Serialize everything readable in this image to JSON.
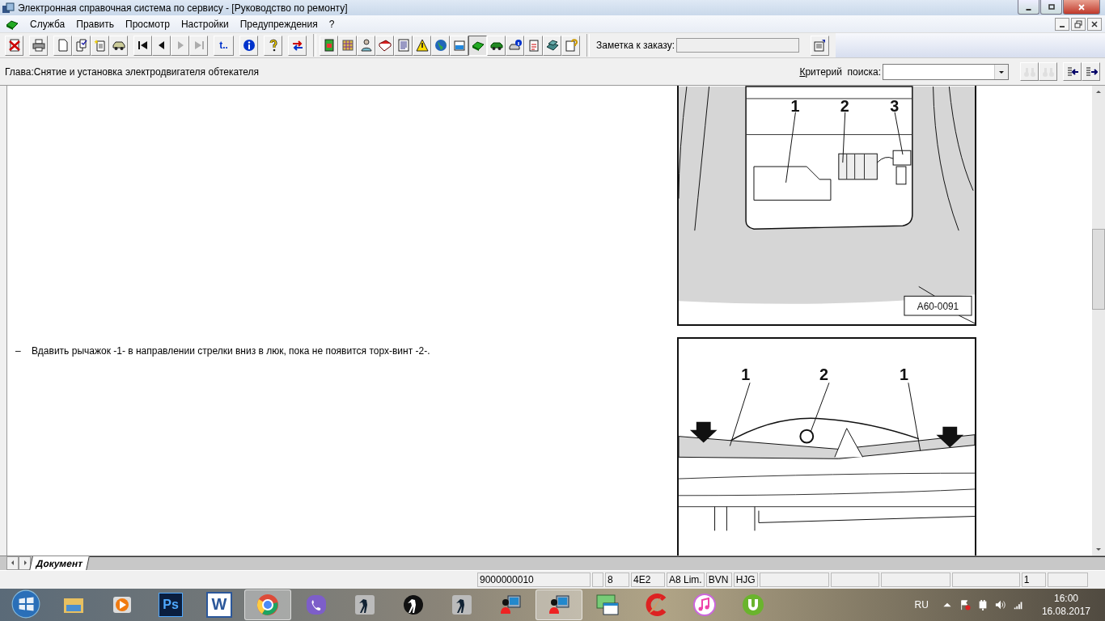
{
  "window": {
    "title": "Электронная справочная система по сервису - [Руководство по ремонту]"
  },
  "menu": [
    {
      "label": "Служба"
    },
    {
      "label": "Править"
    },
    {
      "label": "Просмотр"
    },
    {
      "label": "Настройки"
    },
    {
      "label": "Предупреждения"
    },
    {
      "label": "?"
    }
  ],
  "toolbar": [
    {
      "disabled": false,
      "selected": false
    },
    {
      "disabled": false,
      "selected": false
    },
    {
      "disabled": false,
      "selected": false
    },
    {
      "disabled": false,
      "selected": false
    },
    {
      "disabled": false,
      "selected": false
    },
    {
      "disabled": false,
      "selected": false
    },
    {
      "disabled": false,
      "selected": false
    },
    {
      "disabled": false,
      "selected": false
    },
    {
      "disabled": true,
      "selected": false
    },
    {
      "disabled": true,
      "selected": false
    },
    {
      "disabled": false,
      "selected": false,
      "label": "t.."
    },
    {
      "disabled": false,
      "selected": false
    },
    {
      "disabled": false,
      "selected": false
    },
    {
      "disabled": false,
      "selected": false
    },
    {
      "disabled": false,
      "selected": false
    },
    {
      "disabled": false,
      "selected": false
    },
    {
      "disabled": false,
      "selected": false
    },
    {
      "disabled": false,
      "selected": false
    },
    {
      "disabled": false,
      "selected": false
    },
    {
      "disabled": false,
      "selected": false
    },
    {
      "disabled": false,
      "selected": false
    },
    {
      "disabled": false,
      "selected": false
    },
    {
      "disabled": false,
      "selected": true
    },
    {
      "disabled": false,
      "selected": false
    },
    {
      "disabled": false,
      "selected": false
    },
    {
      "disabled": false,
      "selected": false
    },
    {
      "disabled": false,
      "selected": false
    },
    {
      "disabled": false,
      "selected": false
    }
  ],
  "order_note": {
    "label": "Заметка к заказу:"
  },
  "chapter": "Глава:Снятие и установка электродвигателя обтекателя",
  "search": {
    "label": "Критерий  поиска:"
  },
  "content": [
    {
      "figure": {
        "callouts": [
          "1",
          "2",
          "3"
        ],
        "code": "A60-0091"
      }
    },
    {
      "marker": "–",
      "text": "Вдавить рычажок -1- в направлении стрелки вниз в люк, пока не появится торх-винт -2-.",
      "figure": {
        "callouts": [
          "1",
          "2",
          "1"
        ]
      }
    }
  ],
  "tabs": [
    {
      "label": "Документ",
      "selected": true
    }
  ],
  "status_bar": [
    {
      "kind": "text",
      "text": "9000000010"
    },
    {
      "kind": "blank"
    },
    {
      "kind": "text",
      "text": "8"
    },
    {
      "kind": "text",
      "text": "4E2"
    },
    {
      "kind": "text",
      "text": "A8 Lim."
    },
    {
      "kind": "text",
      "text": "BVN"
    },
    {
      "kind": "text",
      "text": "HJG"
    },
    {
      "kind": "blank"
    },
    {
      "kind": "blank"
    },
    {
      "kind": "blank"
    },
    {
      "kind": "blank"
    },
    {
      "kind": "text",
      "text": "1"
    },
    {
      "kind": "blank"
    }
  ],
  "taskbar": {
    "apps": [
      {
        "selected": false
      },
      {
        "selected": false
      },
      {
        "selected": false,
        "label": "Ps"
      },
      {
        "selected": false,
        "label": "W"
      },
      {
        "selected": true
      },
      {
        "selected": false
      },
      {
        "selected": false
      },
      {
        "selected": false
      },
      {
        "selected": false
      },
      {
        "selected": false
      },
      {
        "selected": true
      },
      {
        "selected": false
      },
      {
        "selected": false
      },
      {
        "selected": false
      },
      {
        "selected": false
      }
    ],
    "language": "RU",
    "time": "16:00",
    "date": "16.08.2017"
  }
}
